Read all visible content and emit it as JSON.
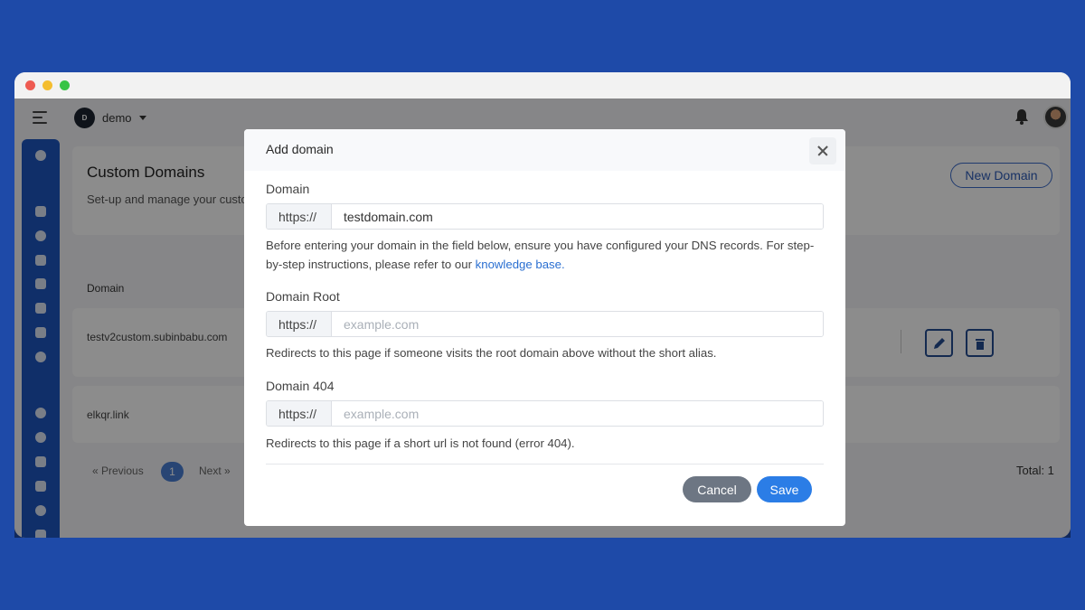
{
  "app": {
    "workspace_initial": "D",
    "workspace_name": "demo"
  },
  "page": {
    "title": "Custom Domains",
    "subtitle": "Set-up and manage your custo",
    "new_domain_label": "New Domain",
    "column_domain": "Domain",
    "rows": [
      {
        "domain": "testv2custom.subinbabu.com"
      },
      {
        "domain": "elkqr.link"
      }
    ],
    "pagination": {
      "previous": "« Previous",
      "current": "1",
      "next": "Next »"
    },
    "total": "Total: 1"
  },
  "modal": {
    "title": "Add domain",
    "domain": {
      "label": "Domain",
      "prefix": "https://",
      "value": "testdomain.com",
      "help": "Before entering your domain in the field below, ensure you have configured your DNS records. For step-by-step instructions, please refer to our",
      "link": "knowledge base."
    },
    "domain_root": {
      "label": "Domain Root",
      "prefix": "https://",
      "placeholder": "example.com",
      "help": "Redirects to this page if someone visits the root domain above without the short alias."
    },
    "domain_404": {
      "label": "Domain 404",
      "prefix": "https://",
      "placeholder": "example.com",
      "help": "Redirects to this page if a short url is not found (error 404)."
    },
    "cancel_label": "Cancel",
    "save_label": "Save"
  },
  "colors": {
    "background": "#1e4aa8",
    "sidebar": "#1e56c0",
    "primary": "#2b7de6",
    "link": "#2a6fd1"
  }
}
